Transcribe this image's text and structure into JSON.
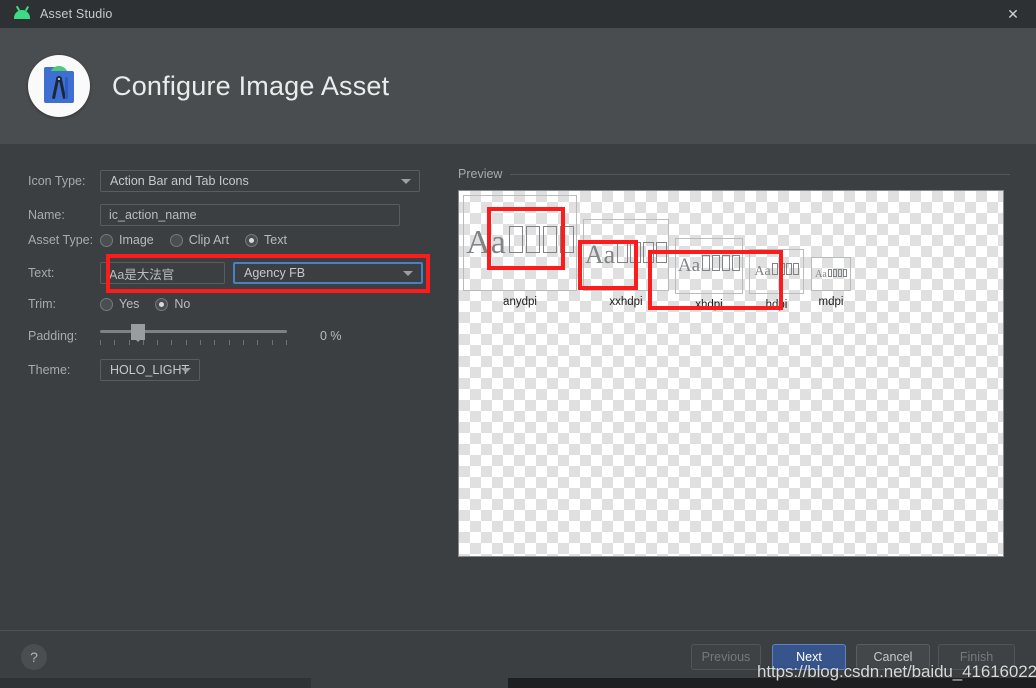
{
  "titlebar": {
    "title": "Asset Studio",
    "icon": "android-icon",
    "close_label": "✕"
  },
  "header": {
    "title": "Configure Image Asset",
    "icon": "android-studio-icon"
  },
  "form": {
    "icon_type": {
      "label": "Icon Type:",
      "value": "Action Bar and Tab Icons"
    },
    "name": {
      "label": "Name:",
      "value": "ic_action_name"
    },
    "asset_type": {
      "label": "Asset Type:",
      "options": [
        "Image",
        "Clip Art",
        "Text"
      ],
      "selected": "Text"
    },
    "text": {
      "label": "Text:",
      "value": "Aa是大法官",
      "font": "Agency FB"
    },
    "trim": {
      "label": "Trim:",
      "options": [
        "Yes",
        "No"
      ],
      "selected": "No"
    },
    "padding": {
      "label": "Padding:",
      "value": "0 %"
    },
    "theme": {
      "label": "Theme:",
      "value": "HOLO_LIGHT"
    }
  },
  "preview": {
    "label": "Preview",
    "items": [
      {
        "label": "anydpi",
        "sample": "Aa"
      },
      {
        "label": "xxhdpi",
        "sample": "Aa"
      },
      {
        "label": "xhdpi",
        "sample": "Aa"
      },
      {
        "label": "hdpi",
        "sample": "Aa"
      },
      {
        "label": "mdpi",
        "sample": "Aa"
      }
    ]
  },
  "footer": {
    "help": "?",
    "previous": "Previous",
    "next": "Next",
    "cancel": "Cancel",
    "finish": "Finish"
  },
  "watermark": "https://blog.csdn.net/baidu_41616022",
  "colors": {
    "window_bg": "#3c3f41",
    "header_bg": "#4a4d4f",
    "titlebar_bg": "#2e3133",
    "accent_blue": "#4a81c4",
    "primary_button": "#37558c",
    "annotation_red": "#fe1b1b"
  }
}
